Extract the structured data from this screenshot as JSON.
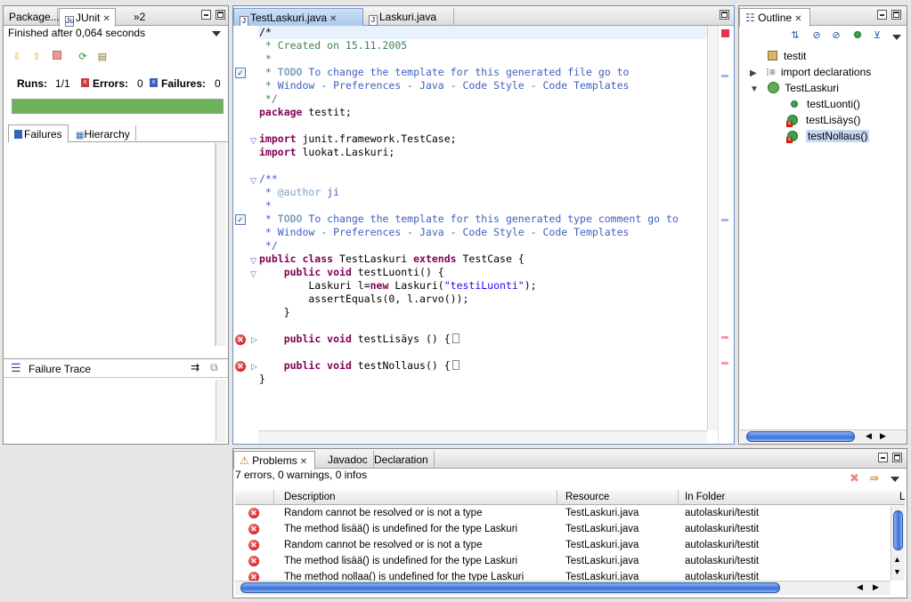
{
  "left_view": {
    "tabs": [
      "Package...",
      "JUnit",
      "»2"
    ],
    "status": "Finished after 0,064 seconds",
    "runs_label": "Runs:",
    "runs_value": "1/1",
    "errors_label": "Errors:",
    "errors_value": "0",
    "failures_label": "Failures:",
    "failures_value": "0",
    "progress": 1.0,
    "progress_color": "#6cb25b",
    "subtabs": [
      "Failures",
      "Hierarchy"
    ],
    "failure_trace_label": "Failure Trace"
  },
  "editor": {
    "tabs": [
      "TestLaskuri.java",
      "Laskuri.java"
    ],
    "lines": [
      {
        "parts": [
          [
            "plain",
            "/*"
          ]
        ]
      },
      {
        "parts": [
          [
            "com",
            " * Created on 15.11.2005"
          ]
        ]
      },
      {
        "parts": [
          [
            "com",
            " *"
          ]
        ]
      },
      {
        "parts": [
          [
            "com",
            " * "
          ],
          [
            "todo",
            "TODO"
          ],
          [
            "doc",
            " To change the template for this generated file go to"
          ]
        ]
      },
      {
        "parts": [
          [
            "com",
            " * "
          ],
          [
            "doc",
            "Window - Preferences - Java - Code Style - Code Templates"
          ]
        ]
      },
      {
        "parts": [
          [
            "com",
            " */"
          ]
        ]
      },
      {
        "parts": [
          [
            "kw",
            "package"
          ],
          [
            "plain",
            " testit;"
          ]
        ]
      },
      {
        "parts": [
          [
            "plain",
            ""
          ]
        ]
      },
      {
        "parts": [
          [
            "kw",
            "import"
          ],
          [
            "plain",
            " junit.framework.TestCase;"
          ]
        ]
      },
      {
        "parts": [
          [
            "kw",
            "import"
          ],
          [
            "plain",
            " luokat.Laskuri;"
          ]
        ]
      },
      {
        "parts": [
          [
            "plain",
            ""
          ]
        ]
      },
      {
        "parts": [
          [
            "doc",
            "/**"
          ]
        ]
      },
      {
        "parts": [
          [
            "doc",
            " * "
          ],
          [
            "tag",
            "@author"
          ],
          [
            "doc",
            " ji"
          ]
        ]
      },
      {
        "parts": [
          [
            "doc",
            " *"
          ]
        ]
      },
      {
        "parts": [
          [
            "doc",
            " * "
          ],
          [
            "todo",
            "TODO"
          ],
          [
            "doc",
            " To change the template for this generated type comment go to"
          ]
        ]
      },
      {
        "parts": [
          [
            "doc",
            " * Window - Preferences - Java - Code Style - Code Templates"
          ]
        ]
      },
      {
        "parts": [
          [
            "doc",
            " */"
          ]
        ]
      },
      {
        "parts": [
          [
            "kw",
            "public class"
          ],
          [
            "plain",
            " TestLaskuri "
          ],
          [
            "kw",
            "extends"
          ],
          [
            "plain",
            " TestCase {"
          ]
        ]
      },
      {
        "parts": [
          [
            "plain",
            "    "
          ],
          [
            "kw",
            "public void"
          ],
          [
            "plain",
            " testLuonti() {"
          ]
        ]
      },
      {
        "parts": [
          [
            "plain",
            "        Laskuri l="
          ],
          [
            "kw",
            "new"
          ],
          [
            "plain",
            " Laskuri("
          ],
          [
            "str",
            "\"testiLuonti\""
          ],
          [
            "plain",
            ");"
          ]
        ]
      },
      {
        "parts": [
          [
            "plain",
            "        assertEquals(0, l.arvo());"
          ]
        ]
      },
      {
        "parts": [
          [
            "plain",
            "    }"
          ]
        ]
      },
      {
        "parts": [
          [
            "plain",
            ""
          ]
        ]
      },
      {
        "parts": [
          [
            "plain",
            "    "
          ],
          [
            "kw",
            "public void"
          ],
          [
            "plain",
            " testLisäys () {"
          ],
          [
            "box",
            ""
          ]
        ]
      },
      {
        "parts": [
          [
            "plain",
            ""
          ]
        ]
      },
      {
        "parts": [
          [
            "plain",
            "    "
          ],
          [
            "kw",
            "public void"
          ],
          [
            "plain",
            " testNollaus() {"
          ],
          [
            "box",
            ""
          ]
        ]
      },
      {
        "parts": [
          [
            "plain",
            "}"
          ]
        ]
      }
    ]
  },
  "outline": {
    "tab": "Outline",
    "items": [
      {
        "label": "testit",
        "icon": "package-icon"
      },
      {
        "label": "import declarations",
        "icon": "imports-icon"
      },
      {
        "label": "TestLaskuri",
        "icon": "class-icon"
      },
      {
        "label": "testLuonti()",
        "icon": "public-method-icon"
      },
      {
        "label": "testLisäys()",
        "icon": "error-method-icon"
      },
      {
        "label": "testNollaus()",
        "icon": "error-method-icon"
      }
    ]
  },
  "problems": {
    "tabs": [
      "Problems",
      "Javadoc",
      "Declaration"
    ],
    "summary": "7 errors, 0 warnings, 0 infos",
    "columns": [
      "Description",
      "Resource",
      "In Folder"
    ],
    "rows": [
      {
        "desc": "Random cannot be resolved or is not a type",
        "resource": "TestLaskuri.java",
        "folder": "autolaskuri/testit"
      },
      {
        "desc": "The method lisää() is undefined for the type Laskuri",
        "resource": "TestLaskuri.java",
        "folder": "autolaskuri/testit"
      },
      {
        "desc": "Random cannot be resolved or is not a type",
        "resource": "TestLaskuri.java",
        "folder": "autolaskuri/testit"
      },
      {
        "desc": "The method lisää() is undefined for the type Laskuri",
        "resource": "TestLaskuri.java",
        "folder": "autolaskuri/testit"
      },
      {
        "desc": "The method nollaa() is undefined for the type Laskuri",
        "resource": "TestLaskuri.java",
        "folder": "autolaskuri/testit"
      }
    ]
  }
}
